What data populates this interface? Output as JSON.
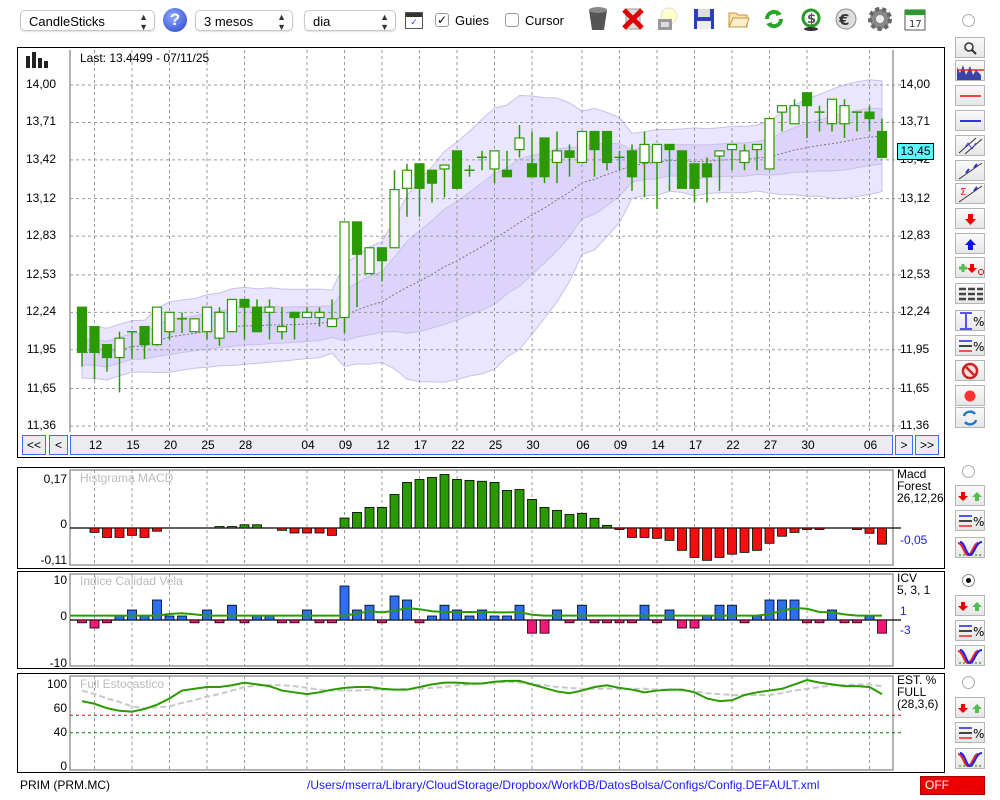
{
  "toolbar": {
    "chart_type": "CandleSticks",
    "help": "?",
    "period": "3 mesos",
    "interval": "dia",
    "guides_label": "Guies",
    "guides_checked": true,
    "cursor_label": "Cursor",
    "cursor_checked": false,
    "icons": [
      "chart-window-icon",
      "trash-icon",
      "delete-icon",
      "lamp-icon",
      "save-icon",
      "folder-open-icon",
      "refresh-icon",
      "dollar-refresh-icon",
      "euro-icon",
      "gear-icon",
      "calendar-icon"
    ],
    "calendar_day": "17"
  },
  "main": {
    "last": "Last: 13.4499 - 07/11/25",
    "price_tag": "13,45",
    "price_ticks": [
      "14,00",
      "13,71",
      "13,42",
      "13,12",
      "12,83",
      "12,53",
      "12,24",
      "11,95",
      "11,65",
      "11,36"
    ],
    "nav": {
      "first": "<<",
      "prev": "<",
      "next": ">",
      "last": ">>"
    },
    "dates": [
      {
        "label": "12",
        "idx": 1
      },
      {
        "label": "15",
        "idx": 4
      },
      {
        "label": "20",
        "idx": 7
      },
      {
        "label": "25",
        "idx": 10
      },
      {
        "label": "28",
        "idx": 13
      },
      {
        "label": "04",
        "idx": 18
      },
      {
        "label": "09",
        "idx": 21
      },
      {
        "label": "12",
        "idx": 24
      },
      {
        "label": "17",
        "idx": 27
      },
      {
        "label": "22",
        "idx": 30
      },
      {
        "label": "25",
        "idx": 33
      },
      {
        "label": "30",
        "idx": 36
      },
      {
        "label": "06",
        "idx": 40
      },
      {
        "label": "09",
        "idx": 43
      },
      {
        "label": "14",
        "idx": 46
      },
      {
        "label": "17",
        "idx": 49
      },
      {
        "label": "22",
        "idx": 52
      },
      {
        "label": "27",
        "idx": 55
      },
      {
        "label": "30",
        "idx": 58
      },
      {
        "label": "06",
        "idx": 63
      }
    ]
  },
  "right_toolbar": [
    "zoom-icon",
    "volume-chart-icon",
    "red-line-icon",
    "blue-line-icon",
    "channel-icon",
    "trendline-icon",
    "sigma-trendline-icon",
    "arrow-down-icon",
    "arrow-up-icon",
    "add-signal-icon",
    "dashed-lines-icon",
    "range-percent-icon",
    "lines-percent-icon",
    "stop-icon",
    "record-icon",
    "swap-icon"
  ],
  "chart_data": {
    "type": "candlestick",
    "ylim": [
      11.36,
      14.0
    ],
    "candles": [
      [
        12.28,
        12.28,
        11.82,
        11.93
      ],
      [
        12.13,
        12.13,
        11.72,
        11.93
      ],
      [
        11.99,
        11.99,
        11.78,
        11.89
      ],
      [
        11.89,
        12.09,
        11.62,
        12.04
      ],
      [
        12.09,
        12.09,
        11.88,
        12.09
      ],
      [
        12.13,
        12.13,
        11.88,
        11.99
      ],
      [
        11.99,
        12.28,
        11.98,
        12.28
      ],
      [
        12.09,
        12.24,
        12.03,
        12.24
      ],
      [
        12.19,
        12.24,
        12.08,
        12.19
      ],
      [
        12.09,
        12.19,
        12.09,
        12.19
      ],
      [
        12.09,
        12.28,
        12.03,
        12.28
      ],
      [
        12.04,
        12.28,
        11.98,
        12.24
      ],
      [
        12.09,
        12.34,
        12.09,
        12.34
      ],
      [
        12.34,
        12.34,
        12.03,
        12.28
      ],
      [
        12.28,
        12.34,
        12.09,
        12.09
      ],
      [
        12.24,
        12.34,
        12.03,
        12.28
      ],
      [
        12.09,
        12.28,
        12.03,
        12.13
      ],
      [
        12.24,
        12.24,
        12.03,
        12.2
      ],
      [
        12.2,
        12.28,
        12.2,
        12.24
      ],
      [
        12.2,
        12.28,
        12.13,
        12.24
      ],
      [
        12.13,
        12.34,
        12.13,
        12.19
      ],
      [
        12.2,
        12.94,
        12.08,
        12.94
      ],
      [
        12.94,
        12.94,
        12.28,
        12.69
      ],
      [
        12.54,
        12.74,
        12.54,
        12.74
      ],
      [
        12.74,
        12.74,
        12.48,
        12.64
      ],
      [
        12.74,
        13.34,
        12.74,
        13.19
      ],
      [
        13.2,
        13.39,
        12.98,
        13.34
      ],
      [
        13.39,
        13.39,
        12.98,
        13.2
      ],
      [
        13.34,
        13.34,
        13.09,
        13.24
      ],
      [
        13.35,
        13.38,
        13.13,
        13.38
      ],
      [
        13.49,
        13.49,
        13.2,
        13.2
      ],
      [
        13.34,
        13.38,
        13.29,
        13.34
      ],
      [
        13.44,
        13.49,
        13.34,
        13.44
      ],
      [
        13.35,
        13.49,
        13.24,
        13.49
      ],
      [
        13.34,
        13.49,
        13.29,
        13.29
      ],
      [
        13.5,
        13.69,
        13.44,
        13.59
      ],
      [
        13.39,
        13.64,
        13.29,
        13.29
      ],
      [
        13.59,
        13.59,
        13.24,
        13.29
      ],
      [
        13.4,
        13.64,
        13.24,
        13.49
      ],
      [
        13.49,
        13.54,
        13.29,
        13.44
      ],
      [
        13.4,
        13.64,
        13.4,
        13.64
      ],
      [
        13.64,
        13.64,
        13.29,
        13.5
      ],
      [
        13.64,
        13.64,
        13.34,
        13.4
      ],
      [
        13.44,
        13.49,
        13.34,
        13.44
      ],
      [
        13.49,
        13.54,
        13.18,
        13.29
      ],
      [
        13.4,
        13.64,
        13.13,
        13.54
      ],
      [
        13.4,
        13.54,
        13.04,
        13.54
      ],
      [
        13.54,
        13.54,
        13.18,
        13.5
      ],
      [
        13.49,
        13.49,
        13.2,
        13.2
      ],
      [
        13.39,
        13.39,
        13.09,
        13.2
      ],
      [
        13.39,
        13.44,
        13.09,
        13.29
      ],
      [
        13.45,
        13.49,
        13.18,
        13.49
      ],
      [
        13.5,
        13.54,
        13.34,
        13.54
      ],
      [
        13.4,
        13.54,
        13.34,
        13.49
      ],
      [
        13.5,
        13.54,
        13.34,
        13.54
      ],
      [
        13.35,
        13.74,
        13.35,
        13.74
      ],
      [
        13.79,
        13.84,
        13.64,
        13.84
      ],
      [
        13.7,
        13.89,
        13.7,
        13.84
      ],
      [
        13.94,
        13.94,
        13.59,
        13.84
      ],
      [
        13.79,
        13.84,
        13.64,
        13.79
      ],
      [
        13.7,
        13.89,
        13.64,
        13.89
      ],
      [
        13.7,
        13.89,
        13.59,
        13.84
      ],
      [
        13.79,
        13.79,
        13.64,
        13.79
      ],
      [
        13.79,
        13.84,
        13.64,
        13.74
      ],
      [
        13.64,
        13.74,
        13.44,
        13.44
      ]
    ],
    "macd": {
      "title": "Histgrama MACD",
      "ylim": [
        -0.11,
        0.17
      ],
      "labels": [
        "0,17",
        "0",
        "-0,11"
      ],
      "legend": [
        "Macd",
        "Forest",
        "26,12,26"
      ],
      "value": "-0,05",
      "hist": [
        0,
        -0.015,
        -0.032,
        -0.032,
        -0.025,
        -0.032,
        -0.011,
        0,
        0,
        0,
        0,
        0.005,
        0.005,
        0.011,
        0.011,
        0,
        -0.008,
        -0.017,
        -0.017,
        -0.017,
        -0.025,
        0.034,
        0.053,
        0.07,
        0.07,
        0.114,
        0.155,
        0.165,
        0.172,
        0.182,
        0.165,
        0.162,
        0.159,
        0.155,
        0.128,
        0.131,
        0.097,
        0.07,
        0.06,
        0.046,
        0.05,
        0.033,
        0.009,
        -0.002,
        -0.032,
        -0.032,
        -0.035,
        -0.042,
        -0.076,
        -0.1,
        -0.11,
        -0.1,
        -0.089,
        -0.083,
        -0.076,
        -0.052,
        -0.028,
        -0.015,
        -0.003,
        -0.003,
        0,
        0,
        -0.003,
        -0.018,
        -0.055
      ]
    },
    "icv": {
      "title": "Indice Calidad Vela",
      "ylim": [
        -10,
        10
      ],
      "labels": [
        "10",
        "0",
        "-10"
      ],
      "legend": [
        "ICV",
        "5, 3, 1"
      ],
      "value1": "1",
      "value2": "-3",
      "bars": [
        -0.7,
        -2,
        -0.7,
        1,
        2.5,
        1,
        5,
        1,
        1,
        -0.7,
        2.5,
        -0.7,
        3.7,
        -0.7,
        1,
        1,
        -0.7,
        -0.7,
        2.5,
        -0.7,
        -0.7,
        8.5,
        2.5,
        3.7,
        -0.7,
        6,
        5,
        -0.7,
        1,
        3.7,
        2.5,
        1,
        2.5,
        1,
        1,
        3.7,
        -3.3,
        -3.3,
        2.5,
        -0.7,
        3.7,
        -0.7,
        -0.7,
        -0.7,
        -0.7,
        3.7,
        -0.7,
        2.5,
        -2,
        -2,
        1,
        3.7,
        3.7,
        -0.7,
        1,
        5,
        5,
        5,
        -0.7,
        -0.7,
        2.5,
        -0.7,
        -0.7,
        1,
        -3.3
      ],
      "signal": [
        1.1,
        1.1,
        1.1,
        1.1,
        1.1,
        1.1,
        1.1,
        1.5,
        1.7,
        1.4,
        1.1,
        1.1,
        1.1,
        1.1,
        1.1,
        1.1,
        1.1,
        1.1,
        1.1,
        1.1,
        1.1,
        1.1,
        1.6,
        2.2,
        1.9,
        2.3,
        3.0,
        2.7,
        2.2,
        2.0,
        2.0,
        2.0,
        2.0,
        1.9,
        1.9,
        2.0,
        1.3,
        1.1,
        1.1,
        1.1,
        1.1,
        1.1,
        1.1,
        1.1,
        1.1,
        1.1,
        1.1,
        1.1,
        1.1,
        1.1,
        1.1,
        1.1,
        1.1,
        1.1,
        1.1,
        1.5,
        2.3,
        3.0,
        2.8,
        2.0,
        1.9,
        1.4,
        1.1,
        1.1,
        1.1
      ]
    },
    "stoch": {
      "title": "Full Estocastico",
      "ylim": [
        0,
        100
      ],
      "labels": [
        "100",
        "60",
        "40",
        "0"
      ],
      "levels": [
        60,
        40
      ],
      "legend": [
        "EST. %",
        "FULL",
        "(28,3,6)"
      ],
      "k": [
        76,
        73,
        68,
        65,
        64,
        67,
        72,
        79,
        88,
        90,
        92,
        92,
        94,
        97,
        95,
        93,
        88,
        86,
        84,
        86,
        89,
        91,
        92,
        92,
        90,
        89,
        89,
        92,
        95,
        97,
        97,
        96,
        96,
        98,
        99,
        99,
        95,
        91,
        87,
        85,
        88,
        92,
        94,
        91,
        89,
        86,
        88,
        89,
        89,
        86,
        79,
        76,
        77,
        83,
        86,
        88,
        90,
        95,
        100,
        97,
        95,
        93,
        93,
        92,
        84
      ],
      "d": [
        88,
        84,
        79,
        75,
        70,
        68,
        69,
        70,
        74,
        77,
        81,
        84,
        88,
        92,
        94,
        94,
        94,
        93,
        91,
        89,
        88,
        88,
        88,
        89,
        89,
        89,
        90,
        90,
        91,
        92,
        94,
        95,
        96,
        97,
        98,
        97,
        95,
        94,
        92,
        91,
        90,
        90,
        90,
        90,
        90,
        90,
        89,
        89,
        88,
        87,
        85,
        84,
        83,
        83,
        83,
        83,
        85,
        88,
        90,
        92,
        94,
        94,
        95,
        95,
        93
      ]
    }
  },
  "footer": {
    "symbol": "PRIM (PRM.MC)",
    "config_path": "/Users/mserra/Library/CloudStorage/Dropbox/WorkDB/DatosBolsa/Configs/Config.DEFAULT.xml",
    "status": "OFF"
  },
  "colors": {
    "candle": "#2a9a00",
    "band_outer": "#ebe6ff",
    "band_inner": "#ddd4fb",
    "macd_pos": "#2a9a00",
    "macd_neg": "#f01010",
    "icv_pos": "#2d6ff2",
    "icv_neg": "#ef1a78",
    "link": "#1a1aff",
    "price_tag": "#5ff8ff",
    "off": "#ee0000"
  }
}
